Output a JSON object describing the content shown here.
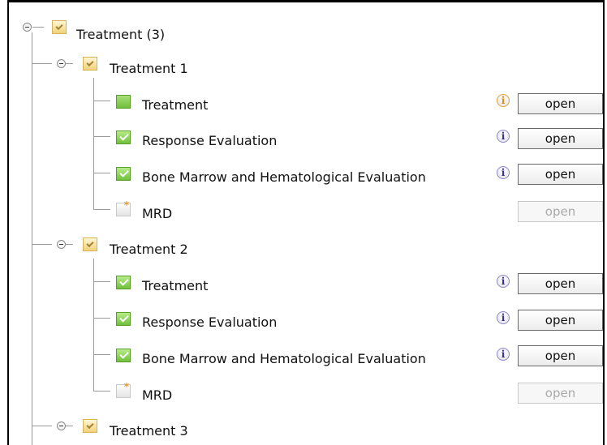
{
  "root": {
    "label": "Treatment (3)"
  },
  "treatments": [
    {
      "label": "Treatment 1",
      "items": [
        {
          "label": "Treatment",
          "status": "in-progress",
          "info": "orange",
          "button": "open",
          "enabled": true
        },
        {
          "label": "Response Evaluation",
          "status": "complete",
          "info": "purple",
          "button": "open",
          "enabled": true
        },
        {
          "label": "Bone Marrow and Hematological Evaluation",
          "status": "complete",
          "info": "purple",
          "button": "open",
          "enabled": true
        },
        {
          "label": "MRD",
          "status": "not-started",
          "info": "",
          "button": "open",
          "enabled": false
        }
      ]
    },
    {
      "label": "Treatment 2",
      "items": [
        {
          "label": "Treatment",
          "status": "complete",
          "info": "purple",
          "button": "open",
          "enabled": true
        },
        {
          "label": "Response Evaluation",
          "status": "complete",
          "info": "purple",
          "button": "open",
          "enabled": true
        },
        {
          "label": "Bone Marrow and Hematological Evaluation",
          "status": "complete",
          "info": "purple",
          "button": "open",
          "enabled": true
        },
        {
          "label": "MRD",
          "status": "not-started",
          "info": "",
          "button": "open",
          "enabled": false
        }
      ]
    },
    {
      "label": "Treatment 3",
      "items": []
    }
  ],
  "info_glyph": "i",
  "colors": {
    "frame": "#000000",
    "connector": "#9a9a9a",
    "info_orange": "#e08a10",
    "info_purple": "#3b2a9a",
    "disabled_text": "#a9a9a9"
  }
}
